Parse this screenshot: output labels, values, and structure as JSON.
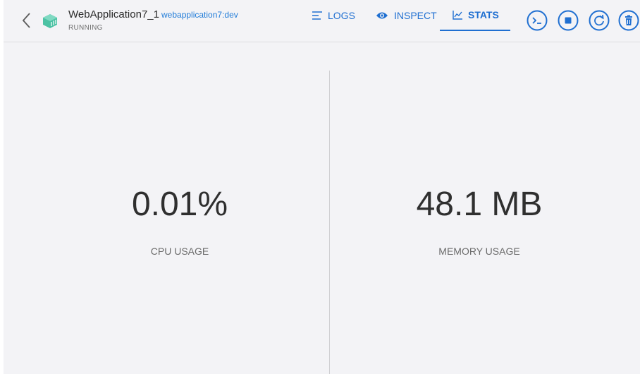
{
  "container": {
    "name": "WebApplication7_1",
    "image": "webapplication7:dev",
    "status": "RUNNING"
  },
  "tabs": [
    {
      "label": "LOGS",
      "icon": "logs-icon"
    },
    {
      "label": "INSPECT",
      "icon": "eye-icon"
    },
    {
      "label": "STATS",
      "icon": "chart-icon",
      "active": true
    }
  ],
  "actions": [
    "terminal-icon",
    "stop-icon",
    "restart-icon",
    "trash-icon"
  ],
  "stats": {
    "cpu": {
      "value": "0.01%",
      "label": "CPU USAGE"
    },
    "memory": {
      "value": "48.1 MB",
      "label": "MEMORY USAGE"
    }
  },
  "colors": {
    "accent": "#1f6fd1",
    "container_icon": "#4cc2a4"
  }
}
